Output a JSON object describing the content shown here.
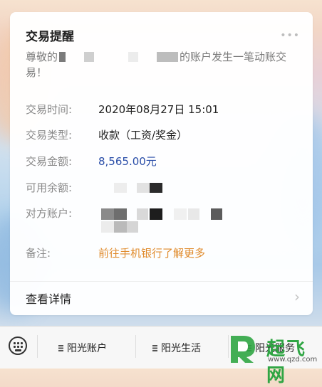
{
  "card": {
    "title": "交易提醒",
    "more_label": "•••",
    "greeting_prefix": "尊敬的",
    "greeting_suffix": "的账户发生一笔动账交易！"
  },
  "fields": [
    {
      "label": "交易时间:",
      "value": "2020年08月27日 15:01"
    },
    {
      "label": "交易类型:",
      "value": "收款（工资/奖金）"
    },
    {
      "label": "交易金额:",
      "value": "8,565.00元"
    },
    {
      "label": "可用余额:",
      "value": ""
    },
    {
      "label": "对方账户:",
      "value": ""
    },
    {
      "label": "备注:",
      "value": "前往手机银行了解更多"
    }
  ],
  "footer": {
    "detail_label": "查看详情",
    "chevron": "›"
  },
  "bottom_bar": {
    "keyboard_icon": "keyboard-icon",
    "menus": [
      "阳光账户",
      "阳光生活",
      "阳光服务"
    ]
  },
  "watermark": {
    "text": "起飞网",
    "url": "www.qzd.com"
  },
  "colors": {
    "amount": "#2a4ea8",
    "link": "#e08b2c",
    "watermark": "#2fa543"
  }
}
